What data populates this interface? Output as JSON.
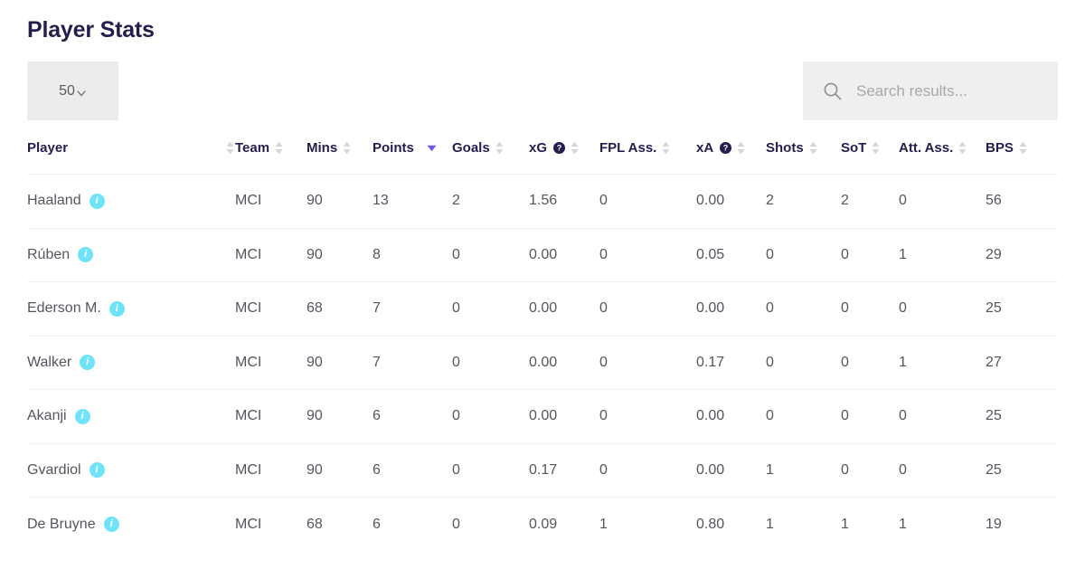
{
  "header": {
    "title": "Player Stats"
  },
  "controls": {
    "page_size": {
      "value": "50",
      "icon": "chevron-down-icon"
    },
    "search": {
      "value": "",
      "placeholder": "Search results...",
      "icon": "search-icon"
    }
  },
  "table": {
    "columns": [
      {
        "key": "player",
        "label": "Player",
        "sortable": true,
        "sort_state": "none",
        "help": false
      },
      {
        "key": "team",
        "label": "Team",
        "sortable": true,
        "sort_state": "none",
        "help": false
      },
      {
        "key": "mins",
        "label": "Mins",
        "sortable": true,
        "sort_state": "none",
        "help": false
      },
      {
        "key": "points",
        "label": "Points",
        "sortable": true,
        "sort_state": "desc",
        "help": false
      },
      {
        "key": "goals",
        "label": "Goals",
        "sortable": true,
        "sort_state": "none",
        "help": false
      },
      {
        "key": "xg",
        "label": "xG",
        "sortable": true,
        "sort_state": "none",
        "help": true
      },
      {
        "key": "fpl_ass",
        "label": "FPL Ass.",
        "sortable": true,
        "sort_state": "none",
        "help": false
      },
      {
        "key": "xa",
        "label": "xA",
        "sortable": true,
        "sort_state": "none",
        "help": true
      },
      {
        "key": "shots",
        "label": "Shots",
        "sortable": true,
        "sort_state": "none",
        "help": false
      },
      {
        "key": "sot",
        "label": "SoT",
        "sortable": true,
        "sort_state": "none",
        "help": false
      },
      {
        "key": "att_ass",
        "label": "Att. Ass.",
        "sortable": true,
        "sort_state": "none",
        "help": false
      },
      {
        "key": "bps",
        "label": "BPS",
        "sortable": true,
        "sort_state": "none",
        "help": false
      }
    ],
    "rows": [
      {
        "player": "Haaland",
        "info": "i",
        "team": "MCI",
        "mins": "90",
        "points": "13",
        "goals": "2",
        "xg": "1.56",
        "fpl_ass": "0",
        "xa": "0.00",
        "shots": "2",
        "sot": "2",
        "att_ass": "0",
        "bps": "56"
      },
      {
        "player": "Rúben",
        "info": "i",
        "team": "MCI",
        "mins": "90",
        "points": "8",
        "goals": "0",
        "xg": "0.00",
        "fpl_ass": "0",
        "xa": "0.05",
        "shots": "0",
        "sot": "0",
        "att_ass": "1",
        "bps": "29"
      },
      {
        "player": "Ederson M.",
        "info": "i",
        "team": "MCI",
        "mins": "68",
        "points": "7",
        "goals": "0",
        "xg": "0.00",
        "fpl_ass": "0",
        "xa": "0.00",
        "shots": "0",
        "sot": "0",
        "att_ass": "0",
        "bps": "25"
      },
      {
        "player": "Walker",
        "info": "i",
        "team": "MCI",
        "mins": "90",
        "points": "7",
        "goals": "0",
        "xg": "0.00",
        "fpl_ass": "0",
        "xa": "0.17",
        "shots": "0",
        "sot": "0",
        "att_ass": "1",
        "bps": "27"
      },
      {
        "player": "Akanji",
        "info": "i",
        "team": "MCI",
        "mins": "90",
        "points": "6",
        "goals": "0",
        "xg": "0.00",
        "fpl_ass": "0",
        "xa": "0.00",
        "shots": "0",
        "sot": "0",
        "att_ass": "0",
        "bps": "25"
      },
      {
        "player": "Gvardiol",
        "info": "i",
        "team": "MCI",
        "mins": "90",
        "points": "6",
        "goals": "0",
        "xg": "0.17",
        "fpl_ass": "0",
        "xa": "0.00",
        "shots": "1",
        "sot": "0",
        "att_ass": "0",
        "bps": "25"
      },
      {
        "player": "De Bruyne",
        "info": "i",
        "team": "MCI",
        "mins": "68",
        "points": "6",
        "goals": "0",
        "xg": "0.09",
        "fpl_ass": "1",
        "xa": "0.80",
        "shots": "1",
        "sot": "1",
        "att_ass": "1",
        "bps": "19"
      }
    ]
  },
  "colors": {
    "title": "#241e4e",
    "header_text": "#241e4e",
    "cell_text": "#555560",
    "info_badge": "#6fe3f7",
    "active_sort": "#6c5ce7",
    "control_bg": "#ececec",
    "divider": "#f1f1f1"
  }
}
